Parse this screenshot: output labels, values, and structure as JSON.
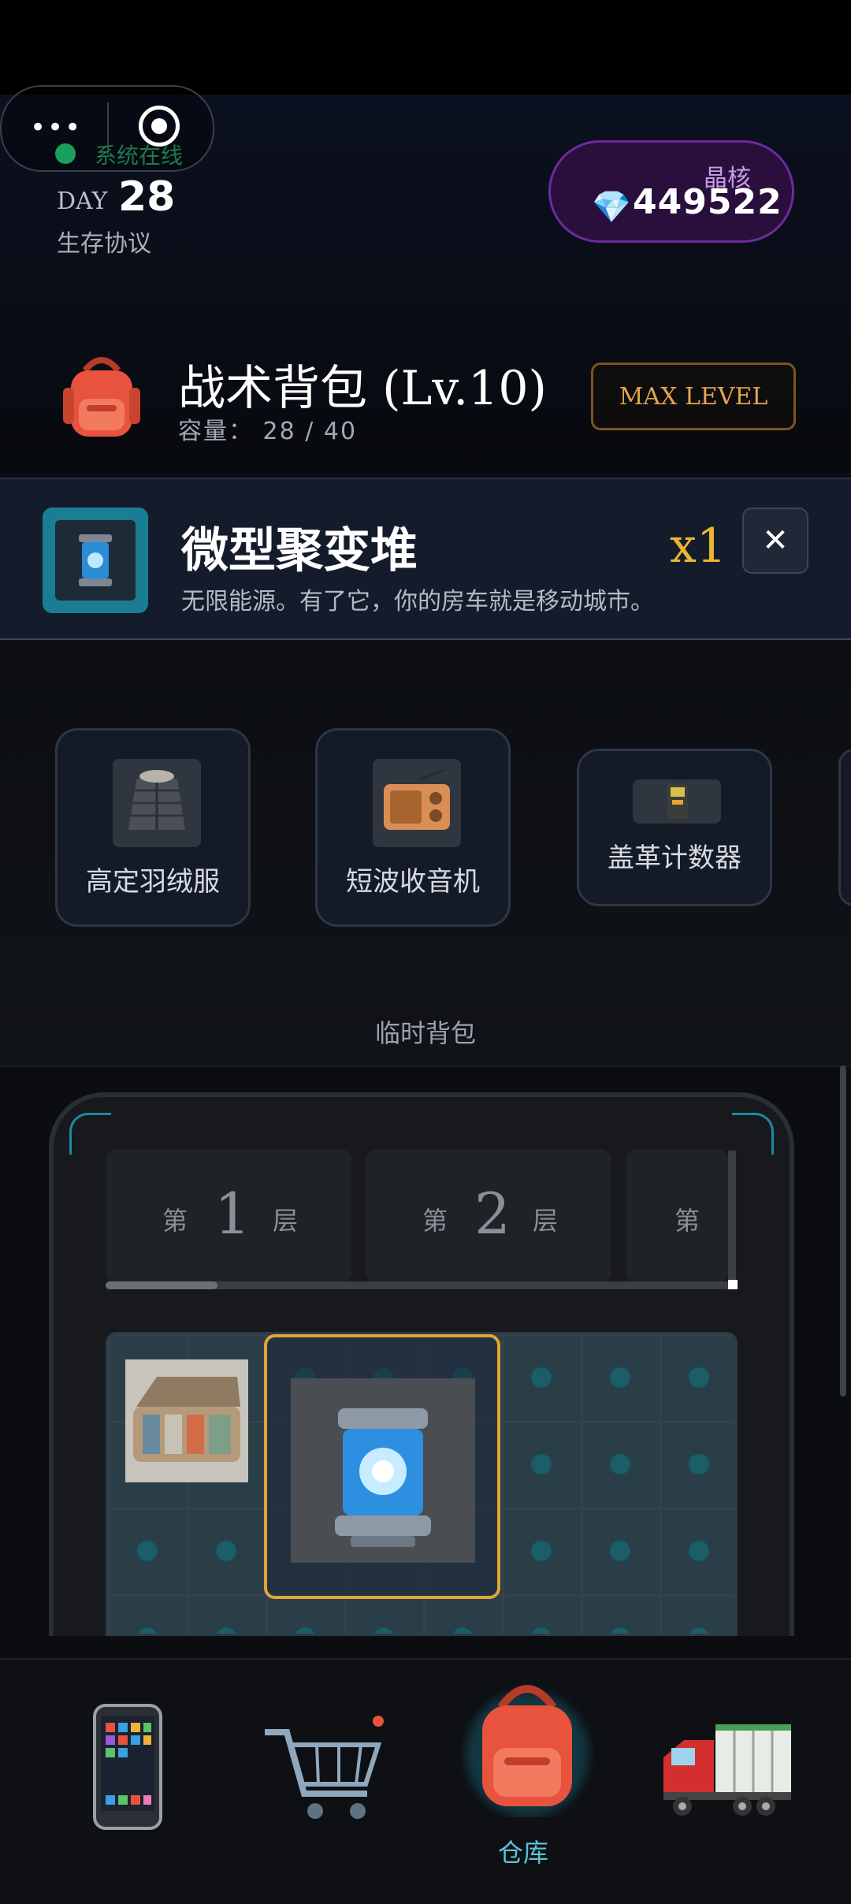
{
  "status": {
    "online_text": "系统在线",
    "day_label": "DAY",
    "day_number": "28",
    "protocol": "生存协议"
  },
  "currency": {
    "label": "晶核",
    "icon": "gem-icon",
    "value": "449522"
  },
  "backpack": {
    "title": "战术背包 (Lv.10)",
    "capacity": "容量： 28 / 40",
    "max_level_label": "MAX LEVEL"
  },
  "selected_item": {
    "name": "微型聚变堆",
    "description": "无限能源。有了它，你的房车就是移动城市。",
    "quantity": "x1",
    "close_icon": "close-icon"
  },
  "temp_items": [
    {
      "label": "高定羽绒服",
      "icon": "down-jacket-icon"
    },
    {
      "label": "短波收音机",
      "icon": "radio-icon"
    },
    {
      "label": "盖革计数器",
      "icon": "geiger-counter-icon"
    }
  ],
  "temp_backpack_label": "临时背包",
  "storage": {
    "tabs": [
      {
        "prefix": "第",
        "number": "1",
        "suffix": "层"
      },
      {
        "prefix": "第",
        "number": "2",
        "suffix": "层"
      },
      {
        "prefix": "第",
        "number": "",
        "suffix": ""
      }
    ]
  },
  "nav": {
    "items": [
      {
        "icon": "phone-icon",
        "label": ""
      },
      {
        "icon": "shopping-cart-icon",
        "label": ""
      },
      {
        "icon": "backpack-icon",
        "label": "仓库"
      },
      {
        "icon": "truck-icon",
        "label": ""
      }
    ],
    "active_color": "#5ec2d8"
  },
  "colors": {
    "accent_gold": "#e9b62f",
    "crystal_purple": "#6f2aa0",
    "online_green": "#1aa05c"
  }
}
